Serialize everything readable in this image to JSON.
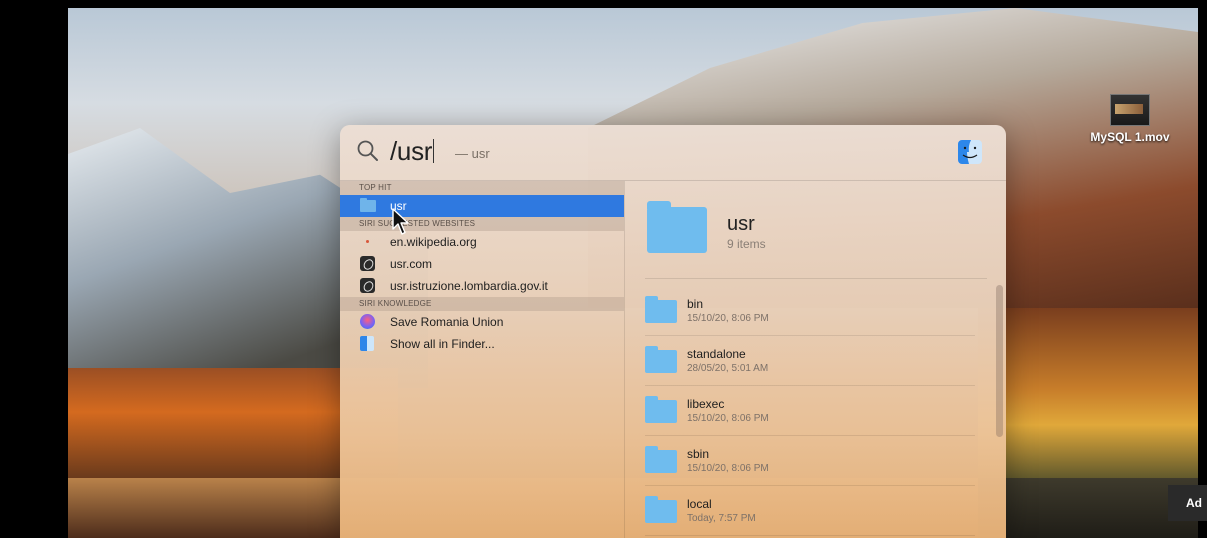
{
  "desktop": {
    "icon_label": "MySQL 1.mov",
    "ad_text": "Ad"
  },
  "search": {
    "query": "/usr",
    "hint": "— usr"
  },
  "sections": [
    {
      "header": "TOP HIT",
      "items": [
        {
          "label": "usr",
          "icon": "folder-icon",
          "selected": true
        }
      ]
    },
    {
      "header": "SIRI SUGGESTED WEBSITES",
      "items": [
        {
          "label": "en.wikipedia.org",
          "icon": "wikipedia-icon"
        },
        {
          "label": "usr.com",
          "icon": "safari-icon"
        },
        {
          "label": "usr.istruzione.lombardia.gov.it",
          "icon": "safari-icon"
        }
      ]
    },
    {
      "header": "SIRI KNOWLEDGE",
      "items": [
        {
          "label": "Save Romania Union",
          "icon": "siri-icon"
        },
        {
          "label": "Show all in Finder...",
          "icon": "finder-icon"
        }
      ]
    }
  ],
  "preview": {
    "title": "usr",
    "subtitle": "9 items",
    "files": [
      {
        "name": "bin",
        "date": "15/10/20, 8:06 PM"
      },
      {
        "name": "standalone",
        "date": "28/05/20, 5:01 AM"
      },
      {
        "name": "libexec",
        "date": "15/10/20, 8:06 PM"
      },
      {
        "name": "sbin",
        "date": "15/10/20, 8:06 PM"
      },
      {
        "name": "local",
        "date": "Today, 7:57 PM"
      }
    ]
  },
  "colors": {
    "selection": "#2f79e0",
    "folder": "#6fbcee"
  }
}
